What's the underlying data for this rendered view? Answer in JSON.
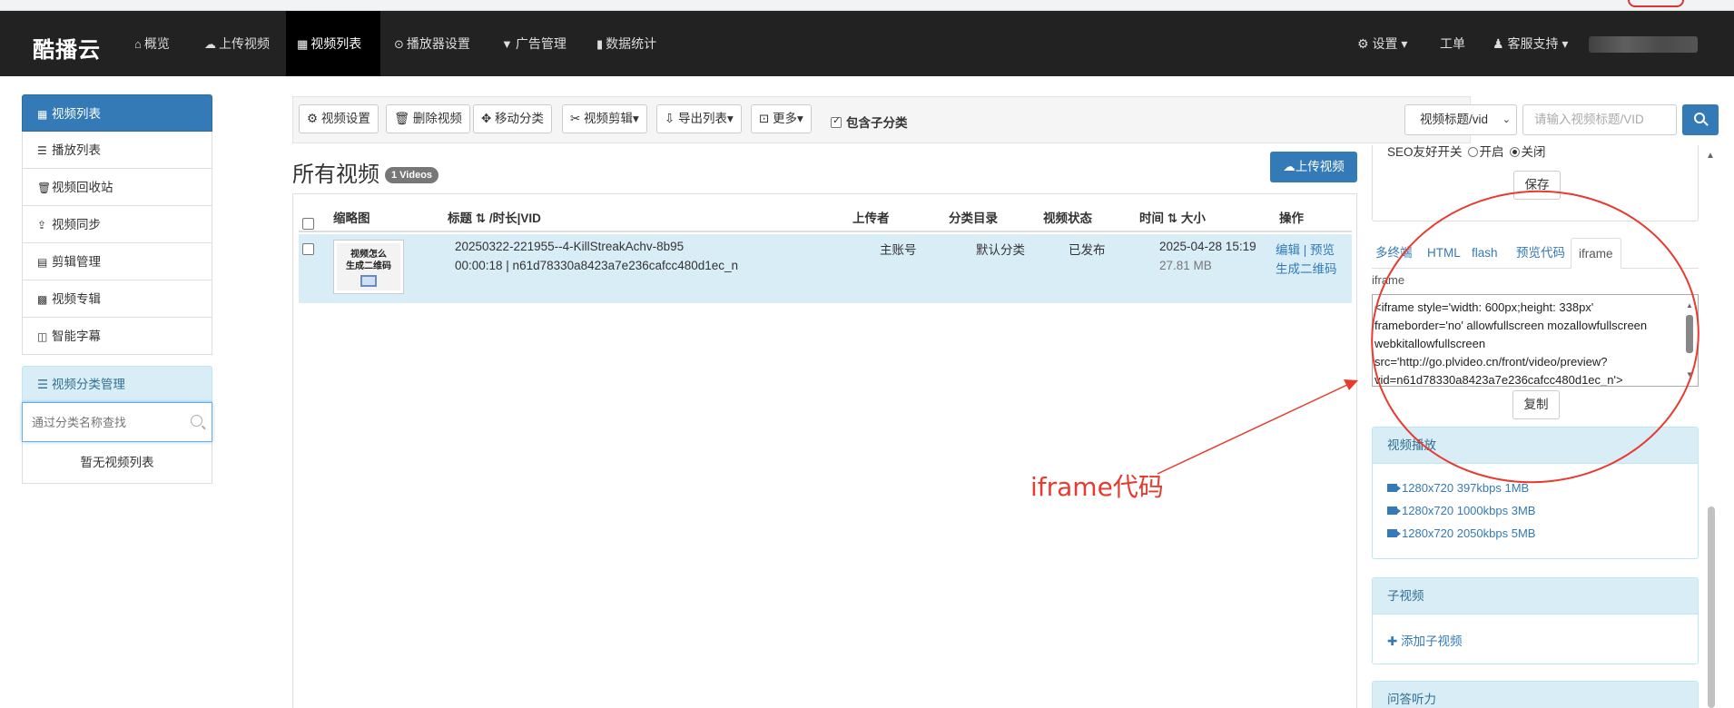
{
  "brand": "酷播云",
  "nav": [
    {
      "icon": "home-icon",
      "glyph": "⌂",
      "label": "概览"
    },
    {
      "icon": "cloud-upload-icon",
      "glyph": "☁",
      "label": "上传视频"
    },
    {
      "icon": "film-icon",
      "glyph": "▦",
      "label": "视频列表",
      "active": true
    },
    {
      "icon": "play-circle-icon",
      "glyph": "⊙",
      "label": "播放器设置"
    },
    {
      "icon": "filter-icon",
      "glyph": "▼",
      "label": "广告管理"
    },
    {
      "icon": "bar-chart-icon",
      "glyph": "▮",
      "label": "数据统计"
    }
  ],
  "nav_right": {
    "settings": "⚙ 设置 ▾",
    "ticket": "工单",
    "support": "♟ 客服支持 ▾"
  },
  "sidebar": {
    "items": [
      {
        "glyph": "▦",
        "label": "视频列表"
      },
      {
        "glyph": "☰",
        "label": "播放列表"
      },
      {
        "glyph": "🗑",
        "label": "视频回收站"
      },
      {
        "glyph": "⇪",
        "label": "视频同步"
      },
      {
        "glyph": "▤",
        "label": "剪辑管理"
      },
      {
        "glyph": "▩",
        "label": "视频专辑"
      },
      {
        "glyph": "◫",
        "label": "智能字幕"
      }
    ],
    "category_header": "☰ 视频分类管理",
    "search_placeholder": "通过分类名称查找",
    "empty_text": "暂无视频列表"
  },
  "toolbar": {
    "buttons": [
      "⚙ 视频设置",
      "🗑 删除视频",
      "✥ 移动分类",
      "✂ 视频剪辑▾",
      "⇩ 导出列表▾",
      "⊡ 更多▾"
    ],
    "include_sub": "包含子分类",
    "select_value": "视频标题/vid",
    "search_placeholder": "请输入视频标题/VID"
  },
  "main": {
    "title": "所有视频",
    "badge": "1 Videos",
    "upload_btn": "☁上传视频"
  },
  "table": {
    "headers": {
      "thumb": "缩略图",
      "title": "标题 ⇅ /时长|VID",
      "uploader": "上传者",
      "category": "分类目录",
      "status": "视频状态",
      "time": "时间 ⇅ 大小",
      "ops": "操作"
    },
    "rows": [
      {
        "thumb_line1": "视频怎么",
        "thumb_line2": "生成二维码",
        "title": "20250322-221955--4-KillStreakAchv-8b95",
        "meta": "00:00:18  |  n61d78330a8423a7e236cafcc480d1ec_n",
        "uploader": "主账号",
        "category": "默认分类",
        "status": "已发布",
        "time": "2025-04-28 15:19",
        "size": "27.81 MB",
        "op_edit": "编辑",
        "op_sep": " | ",
        "op_preview": "预览",
        "op_qr": "生成二维码"
      }
    ]
  },
  "right_panel": {
    "seo_label": "SEO友好开关",
    "seo_on": "开启",
    "seo_off": "关闭",
    "save": "保存",
    "tabs": [
      "多终端",
      "HTML",
      "flash",
      "预览代码",
      "iframe"
    ],
    "iframe_label": "iframe",
    "code_lines": [
      "<iframe style='width: 600px;height: 338px'",
      "frameborder='no' allowfullscreen mozallowfullscreen",
      "webkitallowfullscreen",
      "src='http://go.plvideo.cn/front/video/preview?",
      "vid=n61d78330a8423a7e236cafcc480d1ec_n'>"
    ],
    "copy": "复制",
    "play_header": "视频播放",
    "play_items": [
      "1280x720 397kbps  1MB",
      "1280x720 1000kbps  3MB",
      "1280x720 2050kbps  5MB"
    ],
    "sub_header": "子视频",
    "add_sub": "✚ 添加子视频",
    "qa_header": "问答听力"
  },
  "annotation": {
    "text": "iframe代码",
    "color": "#e83a2e"
  }
}
